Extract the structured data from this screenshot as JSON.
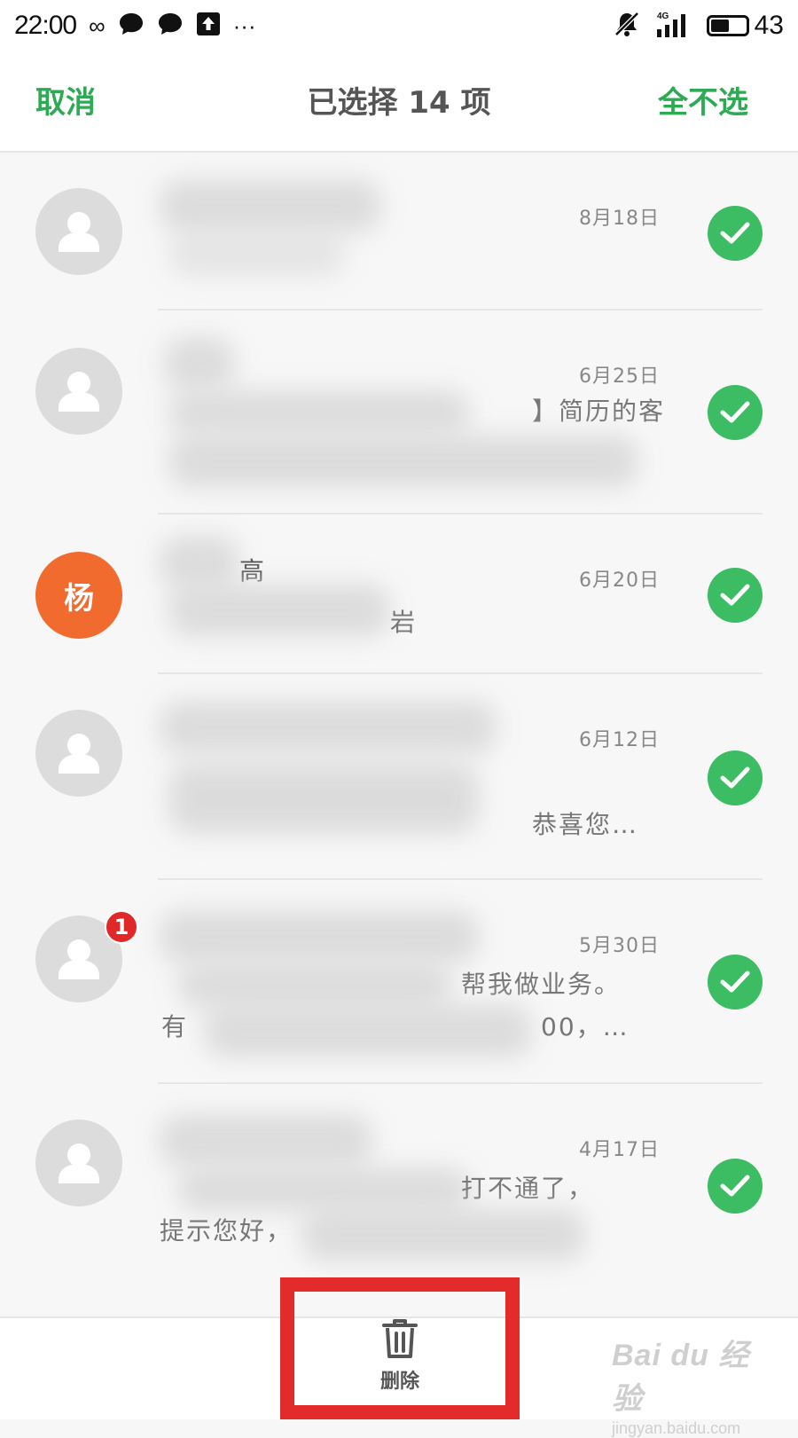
{
  "status_bar": {
    "time": "22:00",
    "left_icons": [
      "infinity-icon",
      "chat-bubble-icon",
      "chat-bubble-icon",
      "upload-icon",
      "more-dots-icon"
    ],
    "signal_label": "4G",
    "battery_level": "43"
  },
  "header": {
    "cancel_label": "取消",
    "title": "已选择 14 项",
    "deselect_all_label": "全不选",
    "accent_color": "#2eaa55"
  },
  "conversations": [
    {
      "date": "8月18日",
      "avatar": "person-icon",
      "selected": true,
      "snippet": ""
    },
    {
      "date": "6月25日",
      "avatar": "person-icon",
      "selected": true,
      "snippet": "】简历的客"
    },
    {
      "date": "6月20日",
      "avatar": "杨",
      "avatar_color": "#f26b2e",
      "selected": true,
      "name_fragment": "高",
      "snippet": "岩"
    },
    {
      "date": "6月12日",
      "avatar": "person-icon",
      "selected": true,
      "snippet": "恭喜您…"
    },
    {
      "date": "5月30日",
      "avatar": "person-icon",
      "badge": "1",
      "selected": true,
      "snippet": "帮我做业务。",
      "snippet2": "有",
      "snippet3": "00，…"
    },
    {
      "date": "4月17日",
      "avatar": "person-icon",
      "selected": true,
      "snippet": "打不通了，",
      "snippet2": "提示您好，"
    }
  ],
  "bottom_bar": {
    "delete_label": "删除",
    "delete_icon": "trash-icon",
    "highlight_color": "#e42b2b"
  },
  "watermark": {
    "brand": "Bai du 经验",
    "url": "jingyan.baidu.com"
  }
}
